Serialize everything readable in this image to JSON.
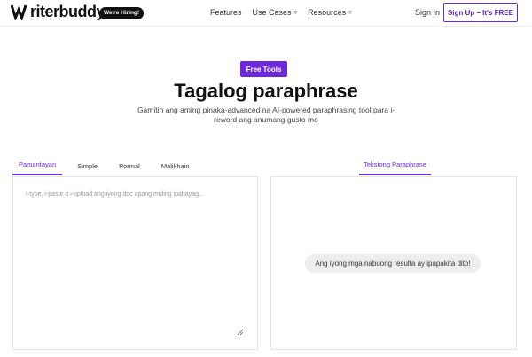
{
  "header": {
    "logo_text": "riterbuddy",
    "hiring_badge": "We're Hiring!",
    "nav": [
      {
        "label": "Features"
      },
      {
        "label": "Use Cases"
      },
      {
        "label": "Resources"
      }
    ],
    "sign_in": "Sign In",
    "sign_up": "Sign Up – It's FREE"
  },
  "hero": {
    "badge": "Free Tools",
    "title": "Tagalog paraphrase",
    "subtitle": "Gamitin ang aming pinaka-advanced na AI-powered paraphrasing tool para i-reword ang anumang gusto mo"
  },
  "tabs": {
    "modes": [
      {
        "label": "Pamantayan",
        "active": true
      },
      {
        "label": "Simple",
        "active": false
      },
      {
        "label": "Pormal",
        "active": false
      },
      {
        "label": "Malikhain",
        "active": false
      }
    ],
    "output_tab": "Tekstong Paraphrase"
  },
  "input": {
    "value": "",
    "placeholder": "I-type, i-paste o i-upload ang iyong doc upang muling ipahayag..."
  },
  "output": {
    "message": "Ang iyong mga nabuong resulta ay ipapakita dito!"
  },
  "colors": {
    "accent": "#6d28d9",
    "text_dark": "#111111"
  }
}
